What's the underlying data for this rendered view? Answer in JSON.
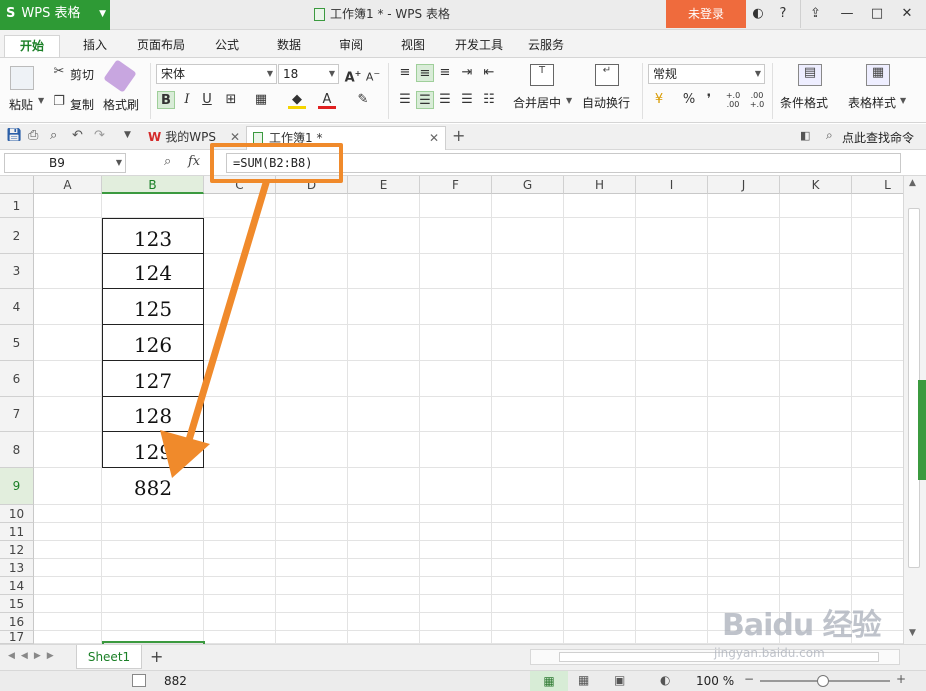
{
  "window": {
    "app_name": "WPS 表格",
    "doc_title": "工作簿1 * - WPS 表格",
    "login_label": "未登录",
    "controls": {
      "skin": "◐",
      "help": "?",
      "min": "—",
      "max": "□",
      "close": "✕",
      "pin": "⇪"
    }
  },
  "menu_tabs": [
    "开始",
    "插入",
    "页面布局",
    "公式",
    "数据",
    "审阅",
    "视图",
    "开发工具",
    "云服务"
  ],
  "ribbon": {
    "paste": "粘贴",
    "cut": "剪切",
    "copy": "复制",
    "format_painter": "格式刷",
    "font_name": "宋体",
    "font_size": "18",
    "bold": "B",
    "italic": "I",
    "underline": "U",
    "font_color": "A",
    "merge_center": "合并居中",
    "wrap_text": "自动换行",
    "number_format": "常规",
    "percent": "%",
    "thousands": "❜",
    "inc_decimal": "+.0 .00",
    "dec_decimal": ".00 +.0",
    "conditional_format": "条件格式",
    "table_style": "表格样式"
  },
  "docbar": {
    "tabs": [
      {
        "label": "我的WPS"
      },
      {
        "label": "工作簿1 *"
      }
    ],
    "find_command": "点此查找命令"
  },
  "formula_bar": {
    "name_box": "B9",
    "fx": "fx",
    "formula": "=SUM(B2:B8)"
  },
  "sheet": {
    "columns": [
      "A",
      "B",
      "C",
      "D",
      "E",
      "F",
      "G",
      "H",
      "I",
      "J",
      "K",
      "L"
    ],
    "rows": [
      "1",
      "2",
      "3",
      "4",
      "5",
      "6",
      "7",
      "8",
      "9",
      "10",
      "11",
      "12",
      "13",
      "14",
      "15",
      "16",
      "17"
    ],
    "values_B": [
      "123",
      "124",
      "125",
      "126",
      "127",
      "128",
      "129"
    ],
    "sum_B9": "882",
    "selected_column": "B",
    "selected_row": "9"
  },
  "sheet_tabs": {
    "active": "Sheet1",
    "add": "+"
  },
  "status": {
    "value": "882",
    "zoom": "100 %"
  },
  "watermark": {
    "brand": "Baidu 经验",
    "url": "jingyan.baidu.com"
  },
  "colors": {
    "green": "#2e9a35",
    "orange": "#f08a2b",
    "login": "#ef6b3d"
  }
}
